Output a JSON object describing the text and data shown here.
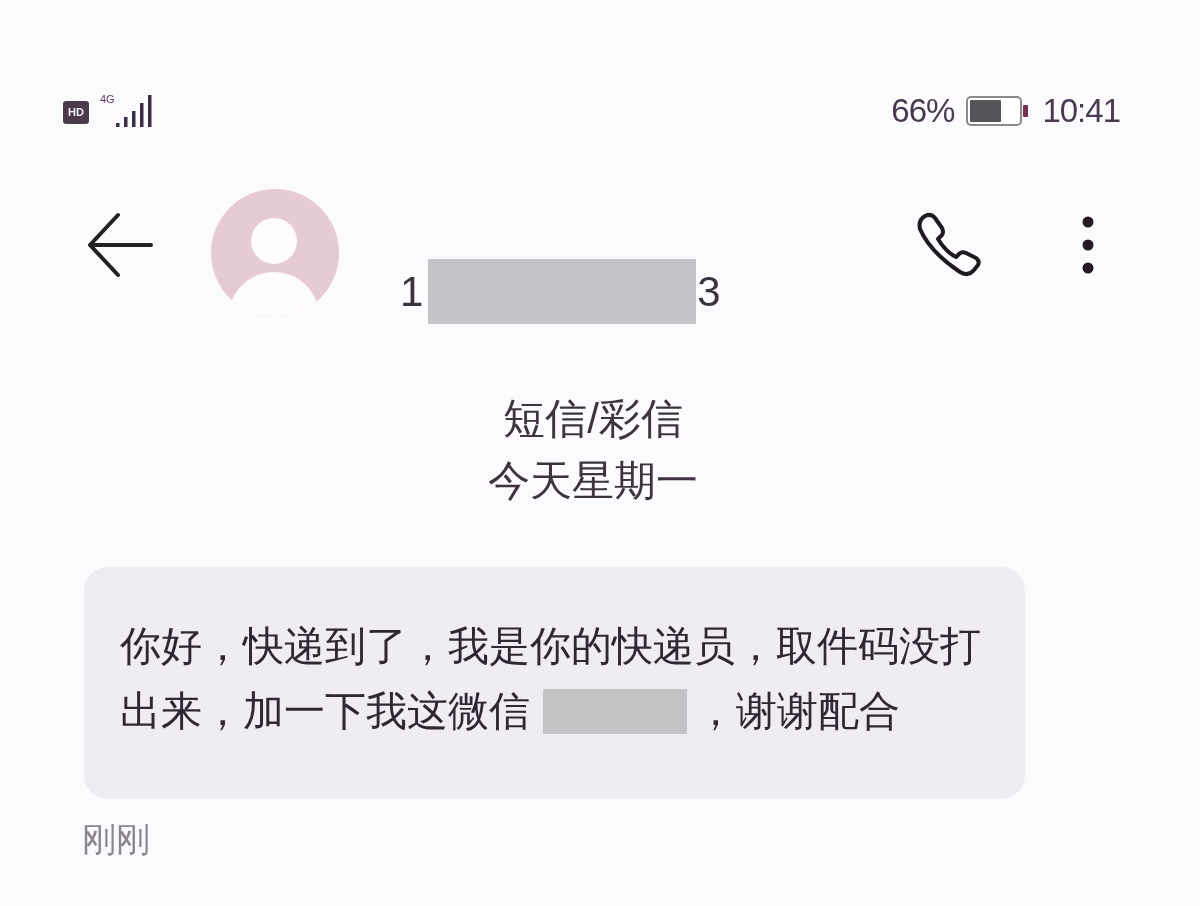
{
  "status_bar": {
    "hd_badge": "HD",
    "network_type": "4G",
    "battery_percent": "66%",
    "time": "10:41"
  },
  "header": {
    "contact_number": [
      {
        "kind": "text",
        "text": "1"
      },
      {
        "kind": "redacted"
      },
      {
        "kind": "text",
        "text": "3"
      }
    ]
  },
  "conversation": {
    "message_type": "短信/彩信",
    "date": "今天星期一",
    "messages": [
      {
        "lines": [
          [
            {
              "kind": "text",
              "text": "你好，快递到了，我是你的快递员，取件码没打"
            }
          ],
          [
            {
              "kind": "text",
              "text": "出来，加一下我这微信"
            },
            {
              "kind": "redacted"
            },
            {
              "kind": "text",
              "text": "，谢谢配合"
            }
          ]
        ],
        "time": "刚刚"
      }
    ]
  }
}
